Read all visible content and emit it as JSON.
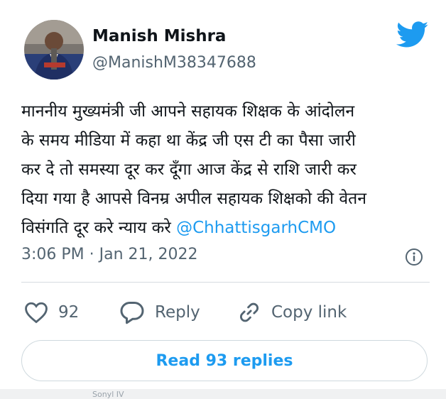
{
  "author": {
    "name": "Manish Mishra",
    "handle": "@ManishM38347688"
  },
  "tweet": {
    "lines": [
      "माननीय मुख्यमंत्री जी आपने सहायक शिक्षक के आंदोलन",
      "के समय मीडिया में कहा था केंद्र जी एस टी का पैसा जारी",
      "कर दे तो समस्या दूर कर दूँगा आज केंद्र से राशि जारी कर",
      "दिया गया है आपसे विनम्र अपील सहायक शिक्षको की वेतन",
      "विसंगति दूर करे न्याय करे "
    ],
    "mention": "@ChhattisgarhCMO",
    "timestamp": "3:06 PM · Jan 21, 2022"
  },
  "actions": {
    "likes_count": "92",
    "reply_label": "Reply",
    "copy_link_label": "Copy link"
  },
  "read_replies_label": "Read 93 replies",
  "bottom_strip_text": "Sonyl IV",
  "colors": {
    "accent": "#1d9bf0",
    "muted": "#536471",
    "text": "#0f1419"
  },
  "icons": {
    "twitter": "twitter-bird-icon",
    "info": "info-icon",
    "like": "heart-icon",
    "reply": "speech-bubble-icon",
    "copy_link": "link-icon"
  }
}
